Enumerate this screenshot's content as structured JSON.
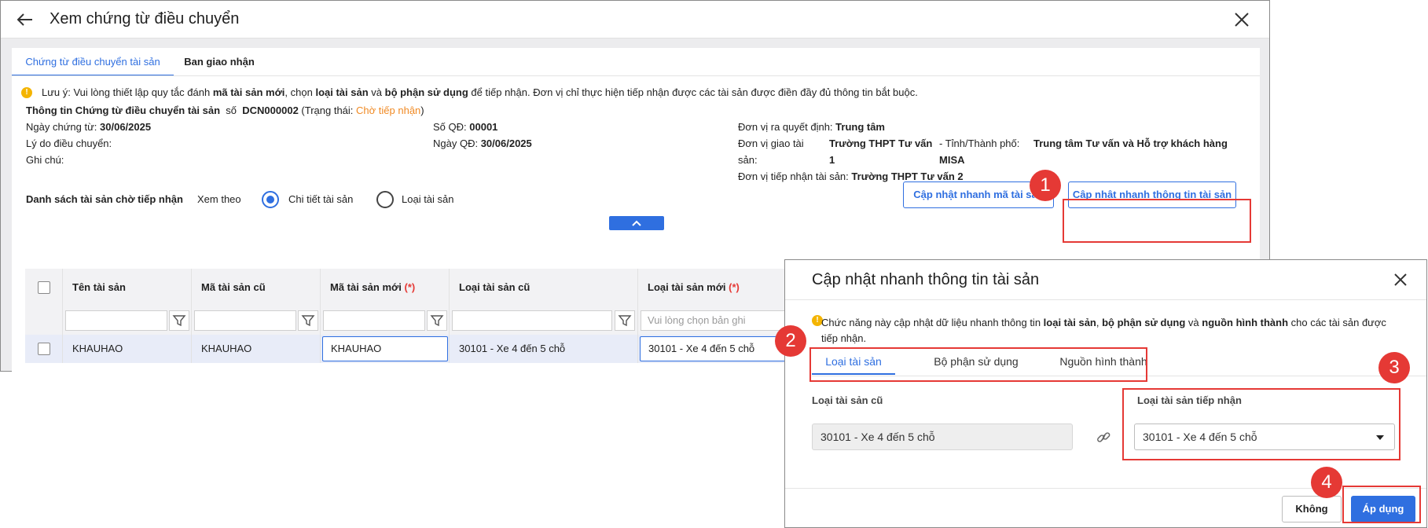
{
  "window": {
    "title": "Xem chứng từ điều chuyển"
  },
  "tabs": [
    "Chứng từ điều chuyển tài sản",
    "Ban giao nhận"
  ],
  "note": {
    "prefix": "Lưu ý: Vui lòng thiết lập quy tắc đánh ",
    "b1": "mã tài sản mới",
    "t1": ", chọn ",
    "b2": "loại tài sản",
    "t2": " và ",
    "b3": "bộ phận sử dụng",
    "t3": " để tiếp nhận. Đơn vị chỉ thực hiện tiếp nhận được các tài sản được điền đầy đủ thông tin bắt buộc."
  },
  "info": {
    "heading": "Thông tin Chứng từ điều chuyển tài sản",
    "so_label": "số",
    "so_value": "DCN000002",
    "status_prefix": "(Trạng thái: ",
    "status_value": "Chờ tiếp nhận",
    "status_suffix": ")",
    "ngay_ct_label": "Ngày chứng từ:",
    "ngay_ct_value": "30/06/2025",
    "ly_do_label": "Lý do điều chuyển:",
    "ghi_chu_label": "Ghi chú:",
    "so_qd_label": "Số QĐ:",
    "so_qd_value": "00001",
    "ngay_qd_label": "Ngày QĐ:",
    "ngay_qd_value": "30/06/2025",
    "dv_ra_qd_label": "Đơn vị ra quyết định:",
    "dv_ra_qd_value": "Trung tâm",
    "dv_giao_label_1": "Đơn vị giao tài",
    "dv_giao_label_2": "sản:",
    "dv_giao_value_1": "Trường THPT Tư vấn",
    "dv_giao_value_2": "1",
    "tinh_label": "- Tỉnh/Thành phố:",
    "tinh_value_1": "Trung tâm Tư vấn và Hỗ trợ khách hàng",
    "tinh_value_2": "MISA",
    "dv_nhan_label": "Đơn vị tiếp nhận tài sản:",
    "dv_nhan_value": "Trường THPT Tư vấn 2"
  },
  "list": {
    "heading": "Danh sách tài sản chờ tiếp nhận",
    "view_label": "Xem theo",
    "radio_detail": "Chi tiết tài sản",
    "radio_type": "Loại tài sản",
    "btn_quick_code": "Cập nhật nhanh mã tài sản",
    "btn_quick_info": "Cập nhật nhanh thông tin tài sản"
  },
  "grid": {
    "columns": [
      "Tên tài sản",
      "Mã tài sản cũ",
      "Mã tài sản mới",
      "Loại tài sản cũ",
      "Loại tài sản mới"
    ],
    "required_mark": "(*)",
    "filter_placeholder": "Vui lòng chọn bản ghi",
    "rows": [
      {
        "name": "KHAUHAO",
        "old_code": "KHAUHAO",
        "new_code": "KHAUHAO",
        "old_type": "30101 - Xe 4 đến 5 chỗ",
        "new_type": "30101 - Xe 4 đến 5 chỗ"
      }
    ]
  },
  "dialog": {
    "title": "Cập nhật nhanh thông tin tài sản",
    "note_prefix": "Chức năng này cập nhật dữ liệu nhanh thông tin ",
    "note_b1": "loại tài sản",
    "note_t1": ", ",
    "note_b2": "bộ phận sử dụng",
    "note_t2": " và ",
    "note_b3": "nguồn hình thành",
    "note_t3": " cho các tài sản được",
    "note_line2": "tiếp nhận.",
    "tabs": [
      "Loại tài sản",
      "Bộ phận sử dụng",
      "Nguồn hình thành"
    ],
    "old_type_label": "Loại tài sản cũ",
    "old_type_value": "30101 - Xe 4 đến 5 chỗ",
    "new_type_label": "Loại tài sản tiếp nhận",
    "new_type_value": "30101 - Xe 4 đến 5 chỗ",
    "btn_cancel": "Không",
    "btn_apply": "Áp dụng"
  },
  "badges": [
    "1",
    "2",
    "3",
    "4"
  ],
  "colors": {
    "accent": "#2f6fe0",
    "highlight": "#e53935",
    "status": "#f08a24"
  }
}
